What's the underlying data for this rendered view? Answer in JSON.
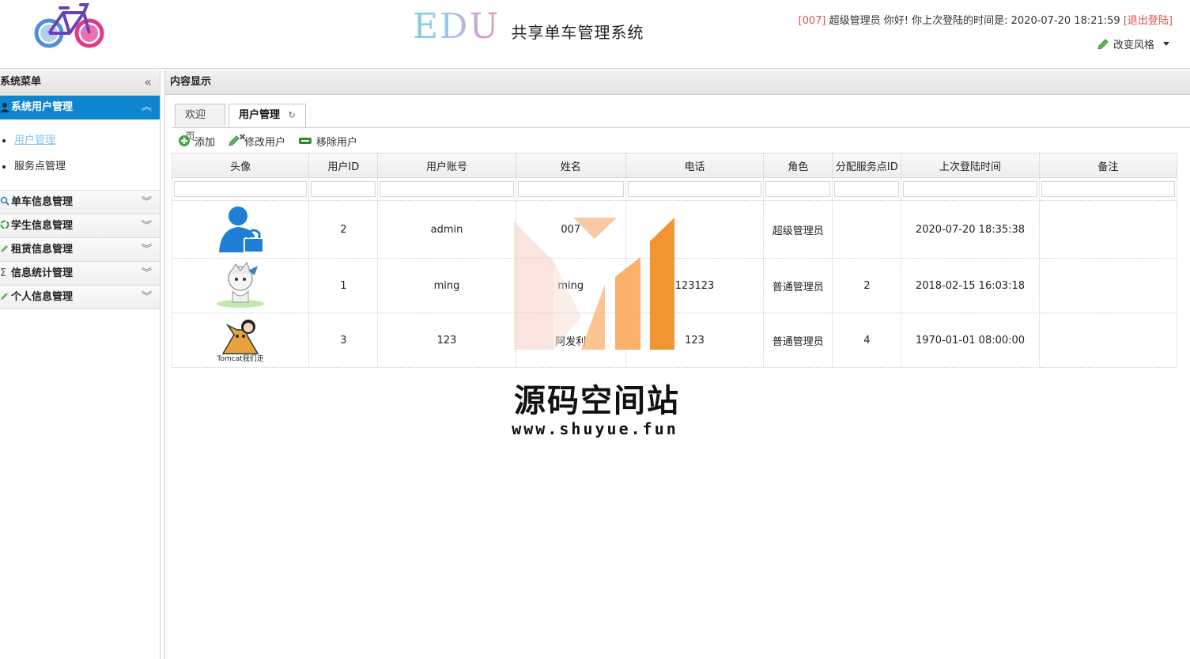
{
  "header": {
    "brand_edu": "EDU",
    "brand_system": "共享单车管理系统",
    "user_prefix": "[007]",
    "user_greeting": "超级管理员 你好! 你上次登陆的时间是: 2020-07-20 18:21:59",
    "logout": "[退出登陆]",
    "theme_label": "改变风格",
    "accent_red": "#d9534f"
  },
  "sidebar": {
    "title": "系统菜单",
    "open_section": "系统用户管理",
    "open_items": [
      {
        "label": "用户管理"
      },
      {
        "label": "服务点管理"
      }
    ],
    "sections": [
      {
        "label": "单车信息管理",
        "icon": "search-icon"
      },
      {
        "label": "学生信息管理",
        "icon": "recycle-icon"
      },
      {
        "label": "租赁信息管理",
        "icon": "pencil-icon"
      },
      {
        "label": "信息统计管理",
        "icon": "sigma-icon"
      },
      {
        "label": "个人信息管理",
        "icon": "pencil-icon"
      }
    ],
    "accent": "#0f85d0"
  },
  "content": {
    "title": "内容显示",
    "tabs": [
      {
        "label": "欢迎页"
      },
      {
        "label": "用户管理",
        "extra": "↻ ✖"
      }
    ],
    "toolbar": {
      "add": "添加",
      "edit": "修改用户",
      "remove": "移除用户"
    },
    "table": {
      "columns": [
        "头像",
        "用户ID",
        "用户账号",
        "姓名",
        "电话",
        "角色",
        "分配服务点ID",
        "上次登陆时间",
        "备注"
      ],
      "rows": [
        {
          "avatar": "lock-user-avatar",
          "id": "2",
          "account": "admin",
          "name": "007",
          "phone": "",
          "role": "超级管理员",
          "station": "",
          "last_login": "2020-07-20 18:35:38",
          "remark": ""
        },
        {
          "avatar": "cartoon-avatar",
          "id": "1",
          "account": "ming",
          "name": "ming",
          "phone": "123123",
          "role": "普通管理员",
          "station": "2",
          "last_login": "2018-02-15 16:03:18",
          "remark": ""
        },
        {
          "avatar": "tomcat-avatar",
          "avatar_caption": "Tomcat我们走",
          "id": "3",
          "account": "123",
          "name": "阿发利",
          "phone": "123",
          "role": "普通管理员",
          "station": "4",
          "last_login": "1970-01-01 08:00:00",
          "remark": ""
        }
      ]
    }
  },
  "watermark": {
    "title": "源码空间站",
    "url": "www.shuyue.fun",
    "color": "#f08a1c"
  }
}
